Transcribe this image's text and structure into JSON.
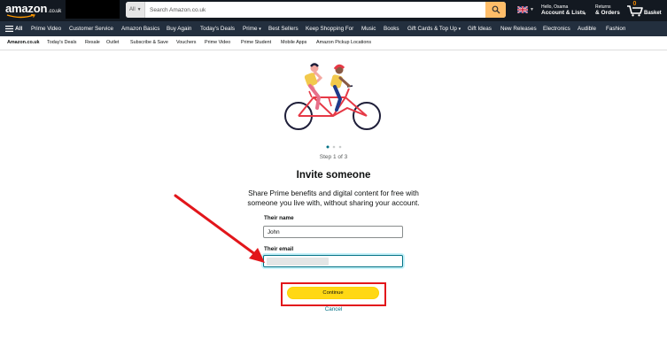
{
  "header": {
    "logo_text": "amazon",
    "logo_tld": ".co.uk",
    "search": {
      "category": "All",
      "placeholder": "Search Amazon.co.uk",
      "value": ""
    },
    "account_greeting": "Hello, Osama",
    "account_label": "Account & Lists",
    "returns_label": "Returns",
    "orders_label": "& Orders",
    "basket_count": "0",
    "basket_label": "Basket"
  },
  "nav": {
    "all_label": "All",
    "items": [
      "Prime Video",
      "Customer Service",
      "Amazon Basics",
      "Buy Again",
      "Today's Deals",
      "Prime",
      "Best Sellers",
      "Keep Shopping For",
      "Music",
      "Books",
      "Gift Cards & Top Up",
      "Gift Ideas",
      "New Releases",
      "Electronics",
      "Audible",
      "Fashion"
    ]
  },
  "subnav": {
    "items": [
      "Amazon.co.uk",
      "Today's Deals",
      "Resale",
      "Outlet",
      "Subscribe & Save",
      "Vouchers",
      "Prime Video",
      "Prime Student",
      "Mobile Apps",
      "Amazon Pickup Locations"
    ]
  },
  "main": {
    "step_text": "Step 1 of 3",
    "title": "Invite someone",
    "description": "Share Prime benefits and digital content for free with someone you live with, without sharing your account.",
    "name_label": "Their name",
    "name_value": "John",
    "email_label": "Their email",
    "email_value": "",
    "continue_label": "Continue",
    "cancel_label": "Cancel"
  },
  "colors": {
    "header_bg": "#131921",
    "nav_bg": "#232f3e",
    "search_button": "#febd69",
    "continue_button": "#ffd814",
    "link": "#007185",
    "annotation_red": "#e2161b"
  },
  "icons": [
    "hamburger-icon",
    "search-icon",
    "uk-flag-icon",
    "cart-icon",
    "tandem-bicycle-illustration",
    "red-arrow-annotation"
  ]
}
